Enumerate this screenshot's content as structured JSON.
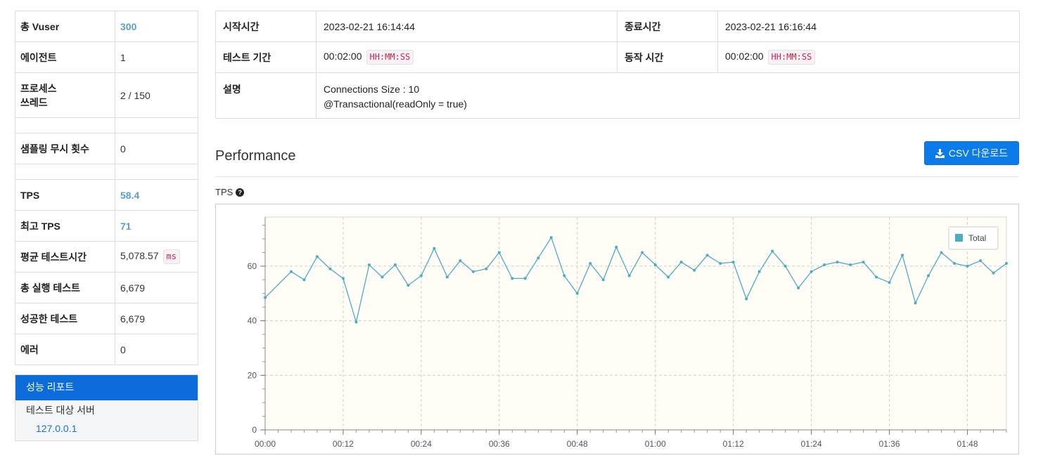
{
  "summary": {
    "rows": [
      {
        "label": "총 Vuser",
        "value": "300",
        "highlight": true
      },
      {
        "label": "에이전트",
        "value": "1"
      },
      {
        "label_line1": "프로세스",
        "label_line2": "쓰레드",
        "value": "2 / 150"
      },
      {
        "label": "샘플링 무시 횟수",
        "value": "0"
      },
      {
        "label": "TPS",
        "value": "58.4",
        "highlight": true
      },
      {
        "label": "최고 TPS",
        "value": "71",
        "highlight": true
      },
      {
        "label": "평균 테스트시간",
        "value": "5,078.57",
        "unit": "ms"
      },
      {
        "label": "총 실행 테스트",
        "value": "6,679"
      },
      {
        "label": "성공한 테스트",
        "value": "6,679"
      },
      {
        "label": "에러",
        "value": "0"
      }
    ]
  },
  "nav": {
    "active": "성능 리포트",
    "section": "테스트 대상 서버",
    "server": "127.0.0.1"
  },
  "info": {
    "start_label": "시작시간",
    "start_value": "2023-02-21 16:14:44",
    "end_label": "종료시간",
    "end_value": "2023-02-21 16:16:44",
    "duration_label": "테스트 기간",
    "duration_value": "00:02:00",
    "duration_format": "HH:MM:SS",
    "run_label": "동작 시간",
    "run_value": "00:02:00",
    "run_format": "HH:MM:SS",
    "desc_label": "설명",
    "desc_line1": "Connections Size : 10",
    "desc_line2": "@Transactional(readOnly = true)"
  },
  "performance": {
    "title": "Performance",
    "csv_button": "CSV 다운로드",
    "tps_label": "TPS"
  },
  "colors": {
    "accent": "#0b7bea",
    "nav_active": "#0b6cda",
    "series": "#4bacc6",
    "plot_bg": "#fffdf5",
    "highlight_value": "#5a9fc9"
  },
  "chart_data": {
    "type": "line",
    "ylim": [
      0,
      78
    ],
    "yticks": [
      0,
      20,
      40,
      60
    ],
    "xticks": [
      "00:00",
      "00:12",
      "00:24",
      "00:36",
      "00:48",
      "01:00",
      "01:12",
      "01:24",
      "01:36",
      "01:48"
    ],
    "x_seconds_range": [
      0,
      114
    ],
    "grid": true,
    "legend": "top-right",
    "series": [
      {
        "name": "Total",
        "x": [
          0,
          4,
          6,
          8,
          10,
          12,
          14,
          16,
          18,
          20,
          22,
          24,
          26,
          28,
          30,
          32,
          34,
          36,
          38,
          40,
          42,
          44,
          46,
          48,
          50,
          52,
          54,
          56,
          58,
          60,
          62,
          64,
          66,
          68,
          70,
          72,
          74,
          76,
          78,
          80,
          82,
          84,
          86,
          88,
          90,
          92,
          94,
          96,
          98,
          100,
          102,
          104,
          106,
          108,
          110,
          112,
          114
        ],
        "values": [
          48.5,
          58,
          55,
          63.5,
          59,
          55.5,
          39.5,
          60.5,
          56,
          60.5,
          53,
          56.5,
          66.5,
          56,
          62,
          58,
          59,
          65,
          55.5,
          55.5,
          63,
          70.5,
          56.5,
          50,
          61,
          55,
          67,
          56.5,
          65,
          60.5,
          56,
          61.5,
          58.5,
          64,
          61,
          61.5,
          48,
          58,
          65.5,
          60,
          52,
          58,
          60.5,
          61.5,
          60.5,
          61.5,
          56,
          54,
          64,
          46.5,
          56.5,
          65,
          61,
          60,
          62,
          57.5,
          61
        ]
      }
    ]
  }
}
